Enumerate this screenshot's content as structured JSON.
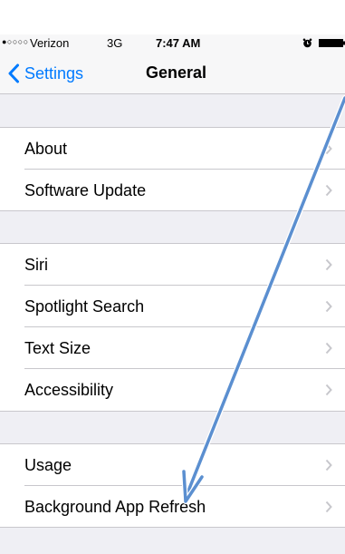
{
  "status_bar": {
    "signal": "●○○○○",
    "carrier": "Verizon",
    "network": "3G",
    "time": "7:47 AM"
  },
  "nav": {
    "back_label": "Settings",
    "title": "General"
  },
  "groups": [
    {
      "items": [
        {
          "label": "About"
        },
        {
          "label": "Software Update"
        }
      ]
    },
    {
      "items": [
        {
          "label": "Siri"
        },
        {
          "label": "Spotlight Search"
        },
        {
          "label": "Text Size"
        },
        {
          "label": "Accessibility"
        }
      ]
    },
    {
      "items": [
        {
          "label": "Usage"
        },
        {
          "label": "Background App Refresh"
        }
      ]
    }
  ],
  "colors": {
    "accent": "#007aff",
    "grouped_background": "#efeff4",
    "separator": "#c8c7cc",
    "chevron": "#c7c7cc",
    "annotation_arrow": "#5b8fd0"
  },
  "icons": {
    "back": "chevron-left-icon",
    "disclosure": "chevron-right-icon",
    "alarm": "alarm-clock-icon",
    "battery": "battery-icon"
  }
}
